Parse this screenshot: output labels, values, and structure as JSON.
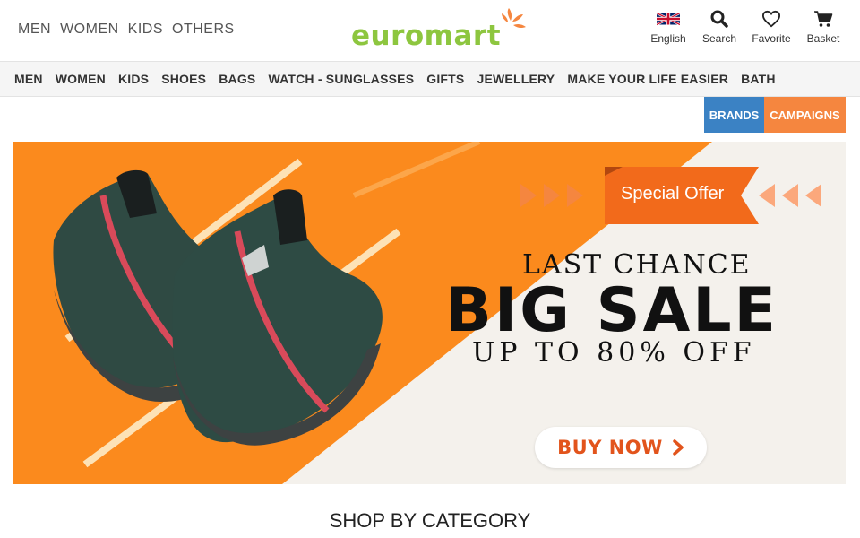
{
  "top_links": [
    "MEN",
    "WOMEN",
    "KIDS",
    "OTHERS"
  ],
  "logo": {
    "text": "euromart",
    "color": "#8dc63f",
    "accent": "#f5863f"
  },
  "header_actions": [
    {
      "label": "English",
      "icon": "uk-flag-icon"
    },
    {
      "label": "Search",
      "icon": "search-icon"
    },
    {
      "label": "Favorite",
      "icon": "heart-icon"
    },
    {
      "label": "Basket",
      "icon": "cart-icon"
    }
  ],
  "nav": [
    "MEN",
    "WOMEN",
    "KIDS",
    "SHOES",
    "BAGS",
    "WATCH - SUNGLASSES",
    "GIFTS",
    "JEWELLERY",
    "MAKE YOUR LIFE EASIER",
    "BATH"
  ],
  "buttons": {
    "brands": "BRANDS",
    "campaigns": "CAMPAIGNS",
    "brands_color": "#3b82c4",
    "campaigns_color": "#f5863f"
  },
  "banner": {
    "special_offer": "Special Offer",
    "line1": "LAST CHANCE",
    "line2": "BIG SALE",
    "line3": "UP TO 80% OFF",
    "cta": "BUY NOW",
    "accent": "#fb8a1d",
    "cta_color": "#e2541c"
  },
  "section_title": "SHOP BY CATEGORY"
}
